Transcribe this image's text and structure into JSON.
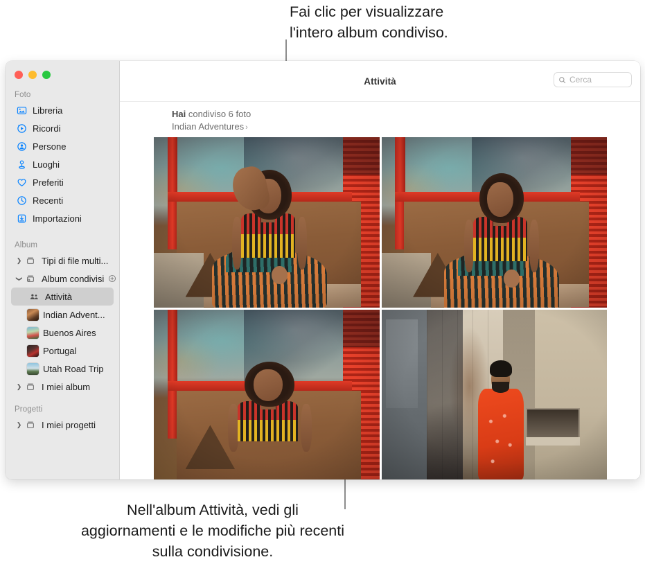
{
  "callouts": {
    "top": "Fai clic per visualizzare\nl'intero album condiviso.",
    "bottom": "Nell'album Attività, vedi gli aggiornamenti e le modifiche più recenti sulla condivisione."
  },
  "window": {
    "traffic_lights": [
      "close",
      "minimize",
      "zoom"
    ]
  },
  "sidebar": {
    "sections": [
      {
        "title": "Foto",
        "items": [
          {
            "label": "Libreria",
            "icon": "library-icon"
          },
          {
            "label": "Ricordi",
            "icon": "memories-icon"
          },
          {
            "label": "Persone",
            "icon": "people-icon"
          },
          {
            "label": "Luoghi",
            "icon": "places-icon"
          },
          {
            "label": "Preferiti",
            "icon": "heart-icon"
          },
          {
            "label": "Recenti",
            "icon": "clock-icon"
          },
          {
            "label": "Importazioni",
            "icon": "import-icon"
          }
        ]
      },
      {
        "title": "Album",
        "items": [
          {
            "label": "Tipi di file multi...",
            "icon": "album-box-icon",
            "disclosure": "collapsed"
          },
          {
            "label": "Album condivisi",
            "icon": "shared-album-icon",
            "disclosure": "expanded",
            "add_button": "add-shared-album"
          },
          {
            "label": "Attività",
            "icon": "activity-people-icon",
            "selected": true
          },
          {
            "label": "Indian Advent...",
            "icon": "album-thumb-indian"
          },
          {
            "label": "Buenos Aires",
            "icon": "album-thumb-buenos"
          },
          {
            "label": "Portugal",
            "icon": "album-thumb-portugal"
          },
          {
            "label": "Utah Road Trip",
            "icon": "album-thumb-utah"
          },
          {
            "label": "I miei album",
            "icon": "album-box-icon",
            "disclosure": "collapsed"
          }
        ]
      },
      {
        "title": "Progetti",
        "items": [
          {
            "label": "I miei progetti",
            "icon": "album-box-icon",
            "disclosure": "collapsed"
          }
        ]
      }
    ]
  },
  "toolbar": {
    "title": "Attività",
    "search_placeholder": "Cerca",
    "search_value": ""
  },
  "activity": {
    "share_prefix": "Hai",
    "share_text": " condiviso 6 foto",
    "album_name": "Indian Adventures",
    "album_chevron": "›",
    "photos": [
      {
        "name": "photo-woman-bench-arm-raised"
      },
      {
        "name": "photo-woman-bench-seated"
      },
      {
        "name": "photo-woman-head-back"
      },
      {
        "name": "photo-man-orange-shirt-door"
      }
    ]
  },
  "colors": {
    "sidebar_bg": "#e9e9e9",
    "selection": "#cfcfcf",
    "accent": "#0a84ff",
    "traffic_red": "#ff5f57",
    "traffic_yellow": "#febc2e",
    "traffic_green": "#28c840"
  }
}
